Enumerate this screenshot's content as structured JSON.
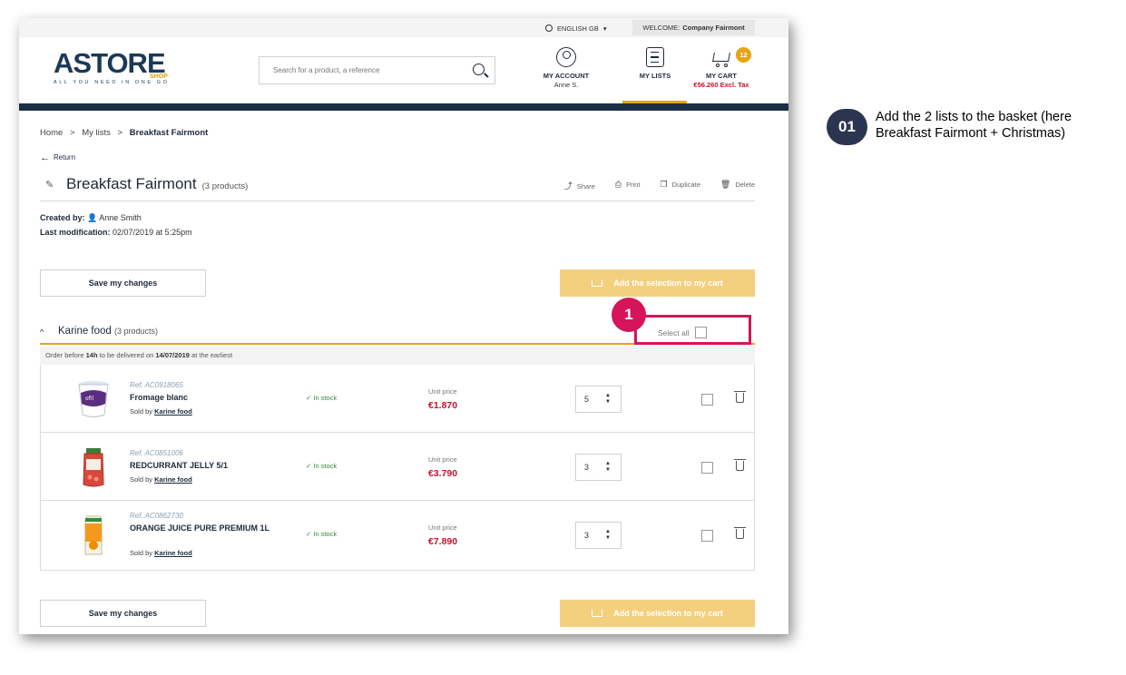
{
  "util": {
    "language": "ENGLISH GB",
    "welcome_label": "WELCOME:",
    "company": "Company Fairmont"
  },
  "header": {
    "logo_text": "ASTORE",
    "logo_shop": "SHOP",
    "logo_tagline": "ALL YOU NEED IN ONE GO",
    "search_placeholder": "Search for a product, a reference",
    "account_label": "MY ACCOUNT",
    "account_user": "Anne S.",
    "lists_label": "MY LISTS",
    "cart_label": "MY CART",
    "cart_amount": "€56.260 Excl. Tax",
    "cart_count": "12"
  },
  "breadcrumb": {
    "home": "Home",
    "sep1": ">",
    "lists": "My lists",
    "sep2": ">",
    "current": "Breakfast Fairmont"
  },
  "back_label": "Return",
  "list": {
    "title": "Breakfast Fairmont",
    "count": "(3 products)",
    "actions": {
      "share": "Share",
      "print": "Print",
      "duplicate": "Duplicate",
      "delete": "Delete"
    },
    "created_label": "Created by:",
    "created_by": "Anne Smith",
    "modified_label": "Last modification:",
    "modified": "02/07/2019 at 5:25pm"
  },
  "buttons": {
    "save": "Save my changes",
    "add": "Add the selection to my cart"
  },
  "group": {
    "name": "Karine food",
    "count": "(3 products)",
    "select_all": "Select all",
    "delivery_pre": "Order before",
    "delivery_hour": "14h",
    "delivery_mid": "to be delivered on",
    "delivery_date": "14/07/2019",
    "delivery_post": "at the earliest"
  },
  "products": [
    {
      "ref": "Ref. AC0918065",
      "name": "Fromage blanc",
      "sold_label": "Sold by",
      "seller": "Karine food",
      "stock": "✓ In stock",
      "unit_label": "Unit price",
      "price": "€1.870",
      "qty": "5"
    },
    {
      "ref": "Ref. AC0851006",
      "name": "REDCURRANT JELLY 5/1",
      "sold_label": "Sold by",
      "seller": "Karine food",
      "stock": "✓ In stock",
      "unit_label": "Unit price",
      "price": "€3.790",
      "qty": "3"
    },
    {
      "ref": "Ref. AC0862730",
      "name": "ORANGE JUICE PURE PREMIUM 1L",
      "sold_label": "Sold by",
      "seller": "Karine food",
      "stock": "✓ In stock",
      "unit_label": "Unit price",
      "price": "€7.890",
      "qty": "3"
    }
  ],
  "annotation": {
    "marker": "1",
    "step_number": "01",
    "step_text": "Add the 2 lists to the basket (here Breakfast Fairmont + Christmas)"
  },
  "colors": {
    "accent": "#e8a317",
    "navy": "#1b2f45",
    "price": "#c8102e",
    "highlight": "#d6145a",
    "add_button": "#f4d07e"
  }
}
